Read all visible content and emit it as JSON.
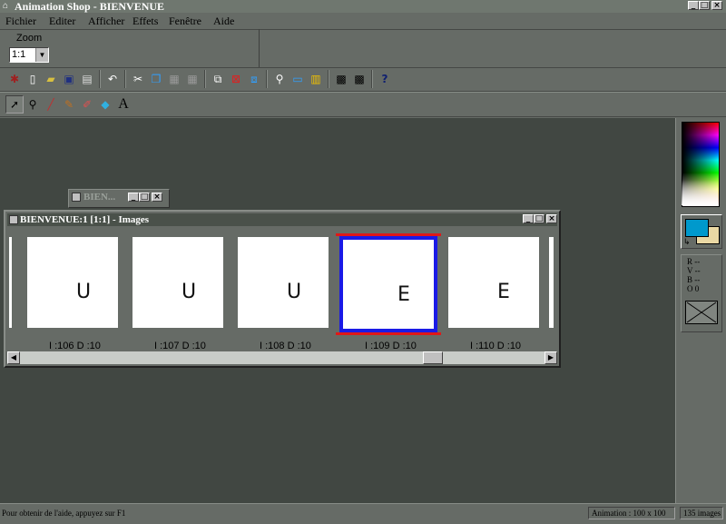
{
  "window": {
    "title": "Animation Shop - BIENVENUE",
    "min_label": "_",
    "max_label": "□",
    "close_label": "×"
  },
  "menu": {
    "items": [
      "Fichier",
      "Editer",
      "Afficher",
      "Effets",
      "Fenêtre",
      "Aide"
    ]
  },
  "zoom": {
    "label": "Zoom",
    "value": "1:1"
  },
  "toolbar": {
    "icons": [
      "wizard-icon",
      "new-icon",
      "open-icon",
      "save-icon",
      "print-icon",
      "undo-icon",
      "cut-icon",
      "copy-icon",
      "paste-icon",
      "paste-into-icon",
      "insert-frames-icon",
      "delete-frames-icon",
      "crop-icon",
      "zoom-icon",
      "frame-properties-icon",
      "palette-icon",
      "filmstrip-icon",
      "view-animation-icon",
      "help-icon"
    ]
  },
  "tools": {
    "icons": [
      "arrow-icon",
      "magnifier-icon",
      "dropper-icon",
      "brush-icon",
      "eraser-icon",
      "fill-icon",
      "text-icon"
    ],
    "text_tool_glyph": "A"
  },
  "mini_window": {
    "title": "BIEN..."
  },
  "document": {
    "title": "BIENVENUE:1 [1:1] - Images",
    "frames": [
      {
        "letter": "U",
        "label": "I :106  D :10",
        "selected": false
      },
      {
        "letter": "U",
        "label": "I :107  D :10",
        "selected": false
      },
      {
        "letter": "U",
        "label": "I :108  D :10",
        "selected": false
      },
      {
        "letter": "E",
        "label": "I :109  D :10",
        "selected": true
      },
      {
        "letter": "E",
        "label": "I :110  D :10",
        "selected": false
      }
    ]
  },
  "colors": {
    "foreground": "#0099cc",
    "background": "#ead8a4",
    "rgb_labels": [
      "R --",
      "V --",
      "B --",
      "O 0"
    ]
  },
  "status": {
    "help": "Pour obtenir de l'aide, appuyez sur F1",
    "animation": "Animation : 100 x 100",
    "count": "135 images"
  }
}
